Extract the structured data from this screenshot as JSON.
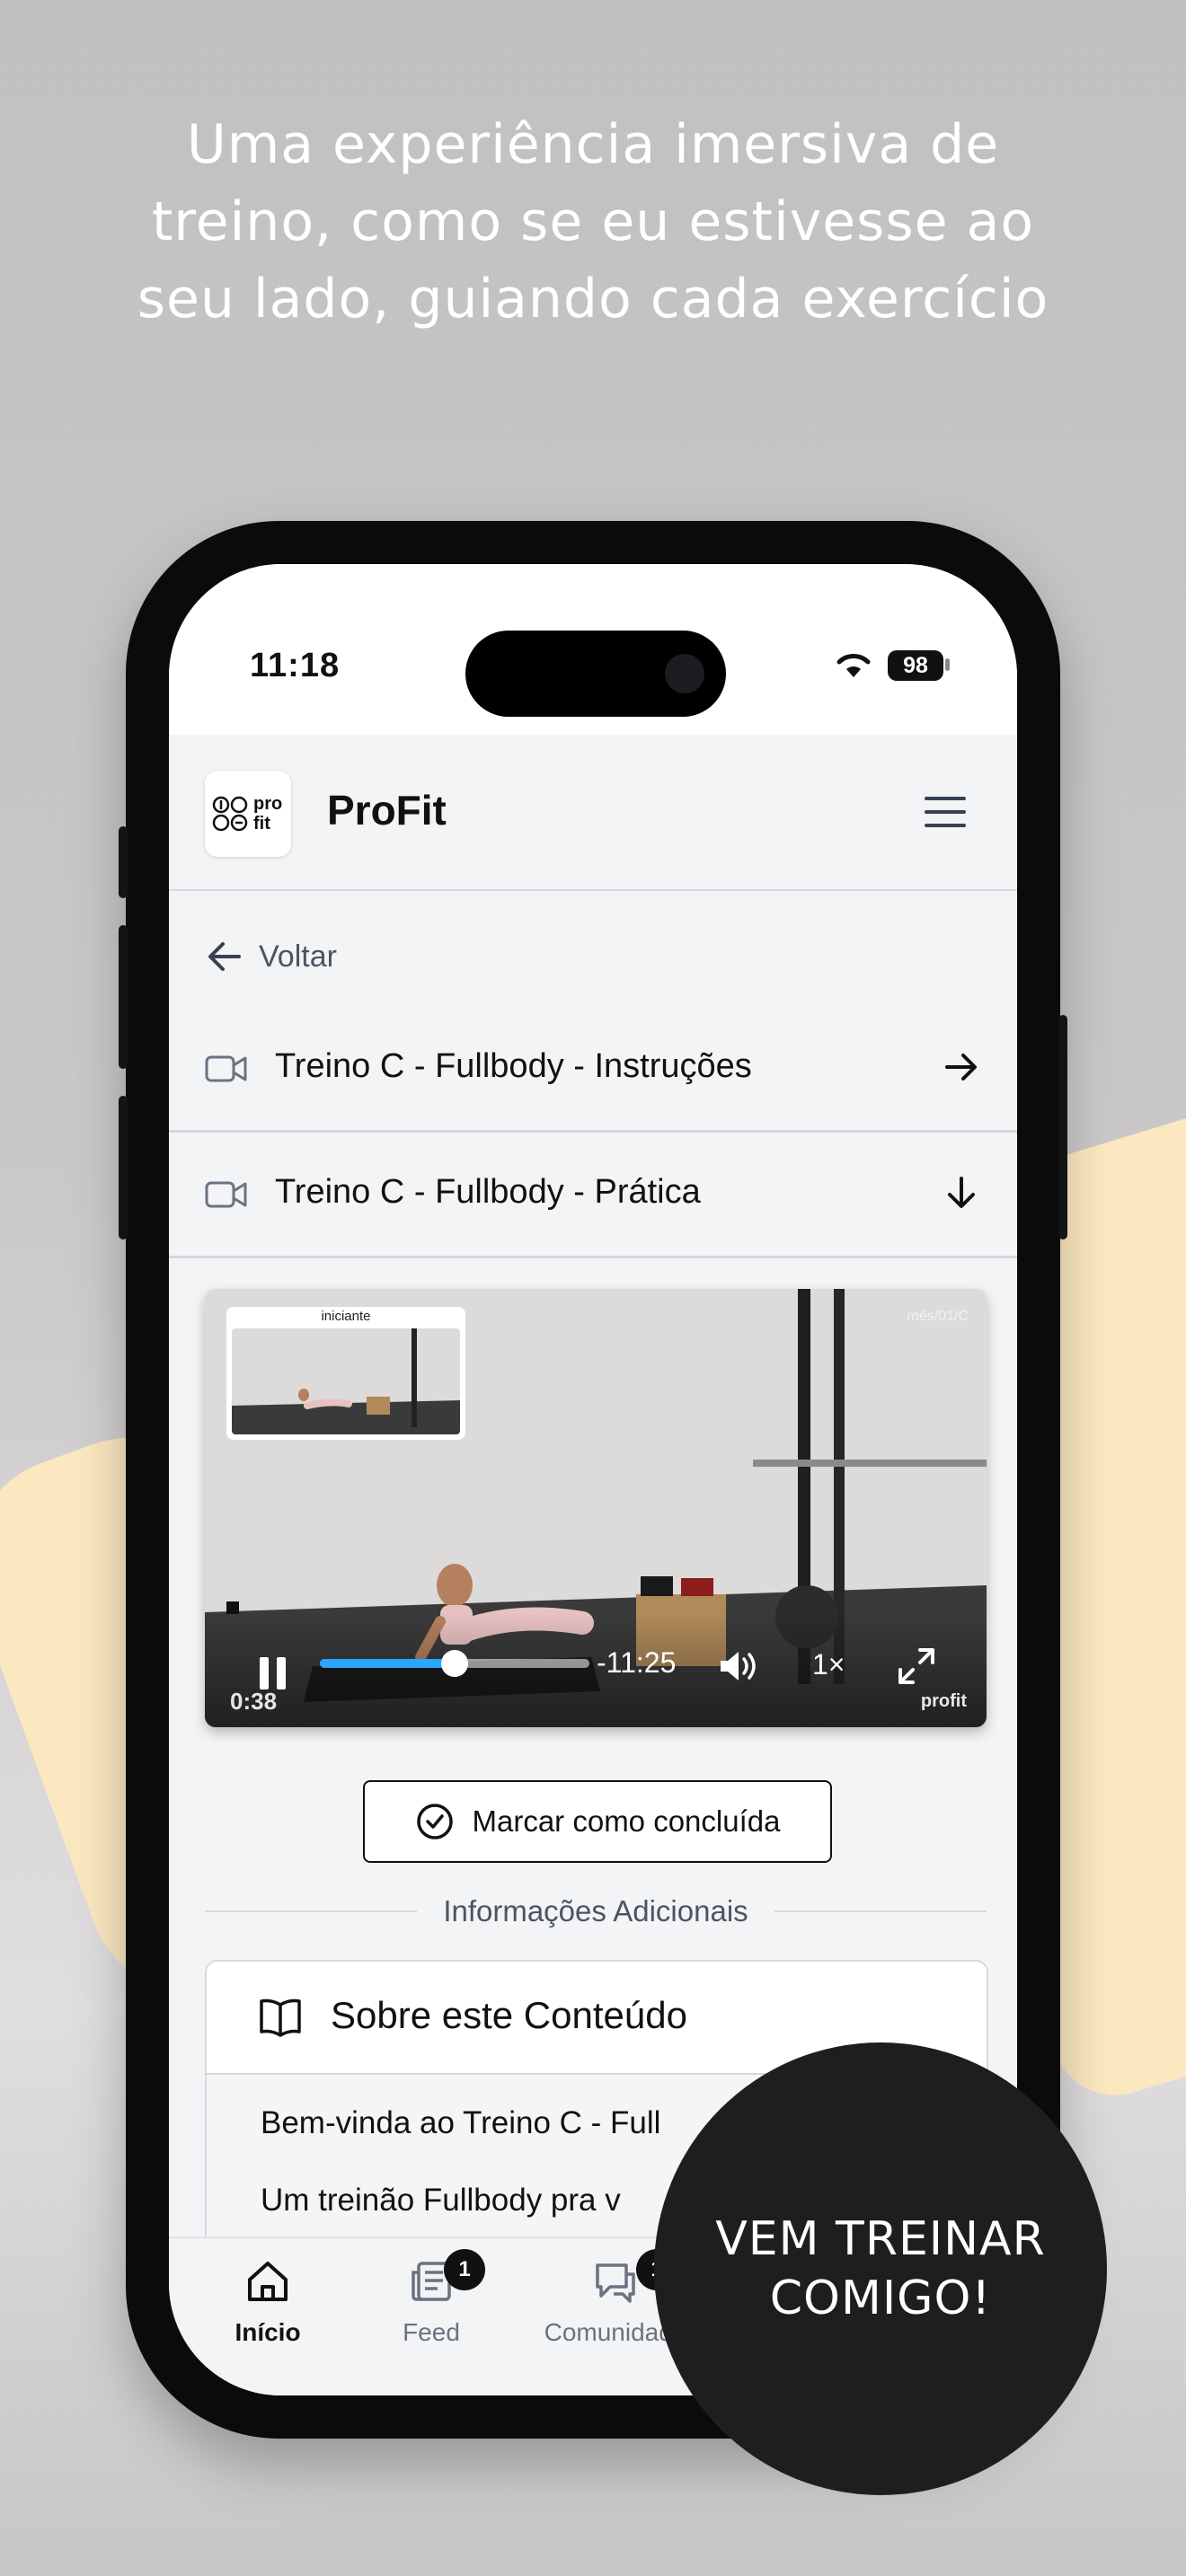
{
  "promo": {
    "headline": "Uma experiência imersiva de treino, como se eu estivesse ao seu lado, guiando cada exercício",
    "cta": "VEM TREINAR COMIGO!"
  },
  "status_bar": {
    "time": "11:18",
    "battery": "98"
  },
  "app": {
    "name": "ProFit",
    "logo_text_1": "pro",
    "logo_text_2": "fit"
  },
  "nav": {
    "back_label": "Voltar"
  },
  "lessons": [
    {
      "title": "Treino C - Fullbody - Instruções",
      "icon": "video-camera-icon",
      "arrow": "arrow-right-icon"
    },
    {
      "title": "Treino C - Fullbody - Prática",
      "icon": "video-camera-icon",
      "arrow": "arrow-down-icon"
    }
  ],
  "video": {
    "pip_label": "iniciante",
    "tag": "mês/01/C",
    "elapsed": "0:38",
    "remaining": "-11:25",
    "speed": "1×",
    "progress": 0.5,
    "watermark": "profit",
    "accent_color": "#2aa6ff"
  },
  "complete_button": {
    "label": "Marcar como concluída"
  },
  "section": {
    "divider_label": "Informações Adicionais"
  },
  "about": {
    "title": "Sobre este Conteúdo",
    "paragraph_1": "Bem-vinda ao Treino C - Full",
    "paragraph_2": "Um treinão Fullbody pra v"
  },
  "tabbar": {
    "items": [
      {
        "label": "Início",
        "icon": "home-icon",
        "badge": ""
      },
      {
        "label": "Feed",
        "icon": "feed-icon",
        "badge": "1"
      },
      {
        "label": "Comunidade",
        "icon": "chat-icon",
        "badge": "1"
      }
    ]
  },
  "colors": {
    "cta_bg": "#1e1e1e",
    "accent_blob": "#fbe8c0"
  }
}
